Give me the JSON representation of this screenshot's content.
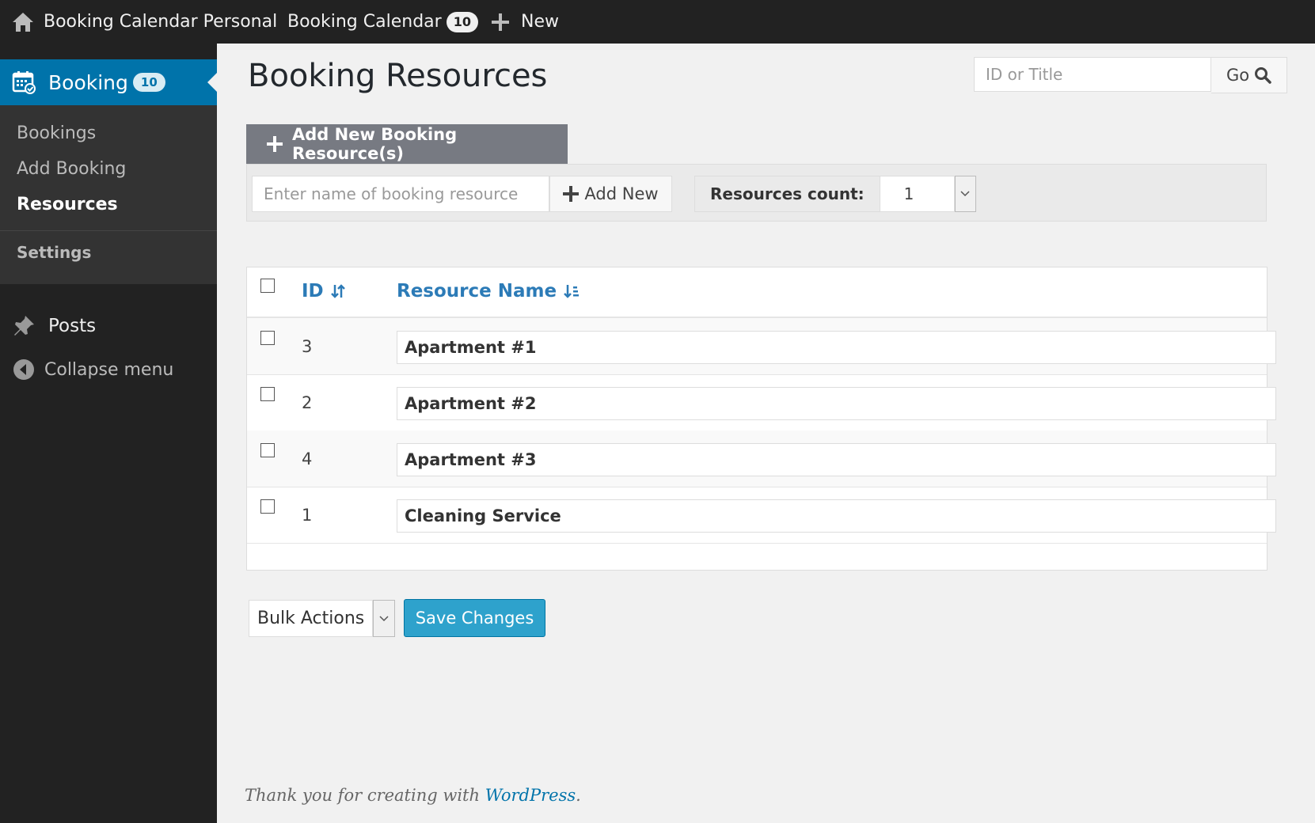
{
  "adminbar": {
    "site_name": "Booking Calendar Personal",
    "plugin_name": "Booking Calendar",
    "plugin_badge": "10",
    "new_label": "New"
  },
  "sidebar": {
    "booking_label": "Booking",
    "booking_badge": "10",
    "submenu": [
      "Bookings",
      "Add Booking",
      "Resources",
      "Settings"
    ],
    "current_submenu": "Resources",
    "posts_label": "Posts",
    "collapse_label": "Collapse menu"
  },
  "page": {
    "title": "Booking Resources",
    "search_placeholder": "ID or Title",
    "go_label": "Go"
  },
  "add_resource": {
    "tab_label": "Add New Booking Resource(s)",
    "input_placeholder": "Enter name of booking resource",
    "add_button": "Add New",
    "count_label": "Resources count:",
    "count_value": "1"
  },
  "table": {
    "col_id": "ID",
    "col_name": "Resource Name",
    "rows": [
      {
        "id": "3",
        "name": "Apartment #1"
      },
      {
        "id": "2",
        "name": "Apartment #2"
      },
      {
        "id": "4",
        "name": "Apartment #3"
      },
      {
        "id": "1",
        "name": "Cleaning Service"
      }
    ]
  },
  "actions": {
    "bulk_label": "Bulk Actions",
    "save_label": "Save Changes"
  },
  "footer": {
    "text_before": "Thank you for creating with ",
    "link_text": "WordPress",
    "text_after": "."
  },
  "colors": {
    "adminbar_bg": "#222222",
    "accent": "#0073aa",
    "save_button": "#2ea2cc",
    "link": "#2c7bb7"
  }
}
